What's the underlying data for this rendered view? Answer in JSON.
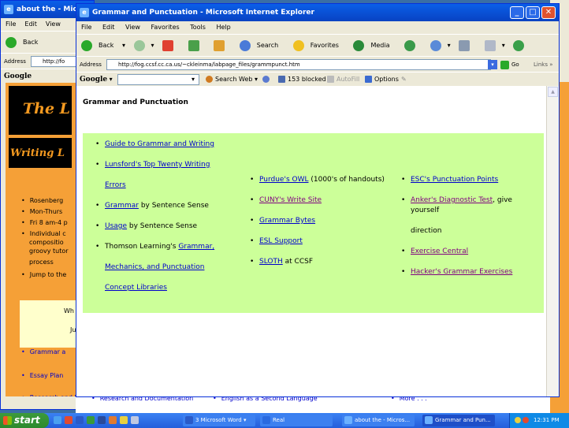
{
  "back_window": {
    "title": "about the - Mic",
    "menu": [
      "File",
      "Edit",
      "View"
    ],
    "back_label": "Back",
    "address_label": "Address",
    "address_value": "http://fo",
    "google_label": "Google",
    "bullets": [
      "Rosenberg",
      "Mon-Thurs",
      "Fri 8 am-4 p",
      "Individual c",
      "compositio",
      "groovy tutor",
      "process",
      "Jump to the"
    ],
    "yellow_text": [
      "Wh",
      "Ju"
    ],
    "bottom_links": [
      "Grammar a",
      "Essay Plan",
      "Research and Documentation"
    ],
    "bottom_mid": "English as a Second Language",
    "bottom_more": "More . . ."
  },
  "window": {
    "title": "Grammar and Punctuation - Microsoft Internet Explorer",
    "menu": [
      "File",
      "Edit",
      "View",
      "Favorites",
      "Tools",
      "Help"
    ],
    "toolbar": {
      "back": "Back",
      "search": "Search",
      "favorites": "Favorites",
      "media": "Media"
    },
    "address": {
      "label": "Address",
      "url": "http://fog.ccsf.cc.ca.us/~ckleinma/labpage_files/grammpunct.htm",
      "go": "Go",
      "links": "Links"
    },
    "google": {
      "label": "Google",
      "search_web": "Search Web",
      "blocked": "153 blocked",
      "autofill": "AutoFill",
      "options": "Options"
    }
  },
  "page": {
    "title": "Grammar and Punctuation",
    "col1": [
      {
        "link": "Guide to Grammar and Writing",
        "suffix": ""
      },
      {
        "link": "Lunsford's Top Twenty Writing",
        "link2": "Errors",
        "suffix": ""
      },
      {
        "link": "Grammar",
        "suffix": " by Sentence Sense"
      },
      {
        "link": "Usage",
        "suffix": " by Sentence Sense"
      },
      {
        "prefix": "Thomson Learning's ",
        "link": "Grammar,",
        "link2": "Mechanics, and Punctuation",
        "link3": "Concept Libraries"
      }
    ],
    "col2": [
      {
        "link": "Purdue's OWL",
        "suffix": " (1000's of handouts)"
      },
      {
        "link": "CUNY's Write Site",
        "suffix": ""
      },
      {
        "link": "Grammar Bytes",
        "suffix": ""
      },
      {
        "link": "ESL Support",
        "suffix": ""
      },
      {
        "link": "SLOTH",
        "suffix": " at CCSF"
      }
    ],
    "col3": [
      {
        "link": "ESC's Punctuation Points",
        "suffix": ""
      },
      {
        "link": "Anker's Diagnostic Test",
        "suffix": ", give yourself",
        "cont": "direction"
      },
      {
        "link": "Exercise Central",
        "suffix": ""
      },
      {
        "link": "Hacker's Grammar Exercises",
        "suffix": ""
      }
    ]
  },
  "taskbar": {
    "start": "start",
    "tasks": [
      "3 Microsoft Word",
      "Real",
      "about the - Micros...",
      "Grammar and Pun..."
    ],
    "clock": "12:31 PM"
  }
}
